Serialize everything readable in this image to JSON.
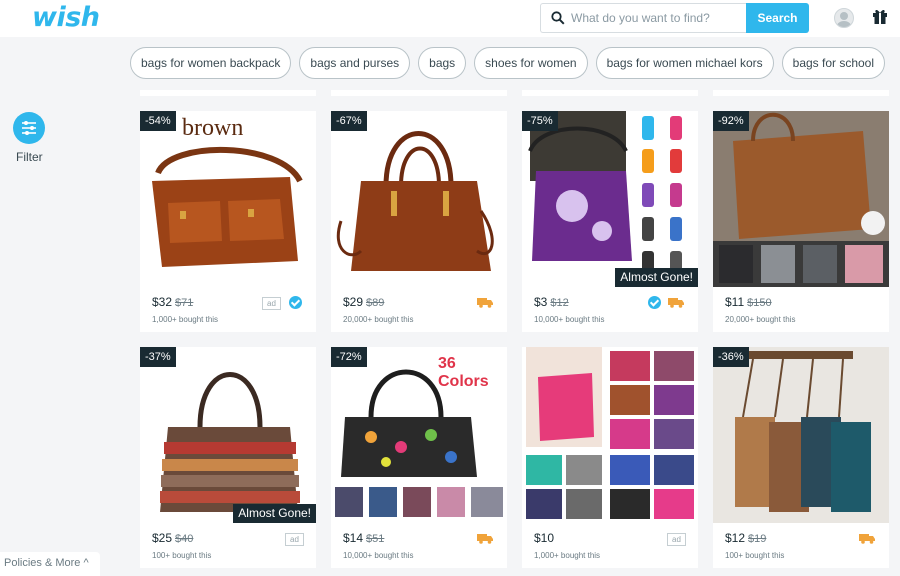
{
  "header": {
    "logo": "wish",
    "search_placeholder": "What do you want to find?",
    "search_button": "Search"
  },
  "chips": [
    "bags for women backpack",
    "bags and purses",
    "bags",
    "shoes for women",
    "bags for women michael kors",
    "bags for school"
  ],
  "sidebar": {
    "filter_label": "Filter"
  },
  "footer": {
    "policies": "Policies & More ^"
  },
  "products": [
    {
      "discount": "-54%",
      "price": "$32",
      "original": "$71",
      "bought": "1,000+ bought this",
      "badge": "",
      "photo_text": "brown",
      "ad": "ad",
      "verified": true,
      "truck": false
    },
    {
      "discount": "-67%",
      "price": "$29",
      "original": "$89",
      "bought": "20,000+ bought this",
      "badge": "",
      "photo_text": "",
      "ad": "",
      "verified": false,
      "truck": true
    },
    {
      "discount": "-75%",
      "price": "$3",
      "original": "$12",
      "bought": "10,000+ bought this",
      "badge": "Almost Gone!",
      "photo_text": "",
      "ad": "",
      "verified": true,
      "truck": true
    },
    {
      "discount": "-92%",
      "price": "$11",
      "original": "$150",
      "bought": "20,000+ bought this",
      "badge": "",
      "photo_text": "",
      "ad": "",
      "verified": false,
      "truck": false
    },
    {
      "discount": "-37%",
      "price": "$25",
      "original": "$40",
      "bought": "100+ bought this",
      "badge": "Almost Gone!",
      "photo_text": "",
      "ad": "ad",
      "verified": false,
      "truck": false
    },
    {
      "discount": "-72%",
      "price": "$14",
      "original": "$51",
      "bought": "10,000+ bought this",
      "badge": "",
      "photo_text": "36 Colors",
      "ad": "",
      "verified": false,
      "truck": true
    },
    {
      "discount": "",
      "price": "$10",
      "original": "",
      "bought": "1,000+ bought this",
      "badge": "",
      "photo_text": "",
      "ad": "ad",
      "verified": false,
      "truck": false
    },
    {
      "discount": "-36%",
      "price": "$12",
      "original": "$19",
      "bought": "100+ bought this",
      "badge": "",
      "photo_text": "",
      "ad": "",
      "verified": false,
      "truck": true
    }
  ],
  "colors": {
    "accent": "#2fb7ec",
    "dark": "#192a32",
    "truck": "#f0a33a"
  }
}
